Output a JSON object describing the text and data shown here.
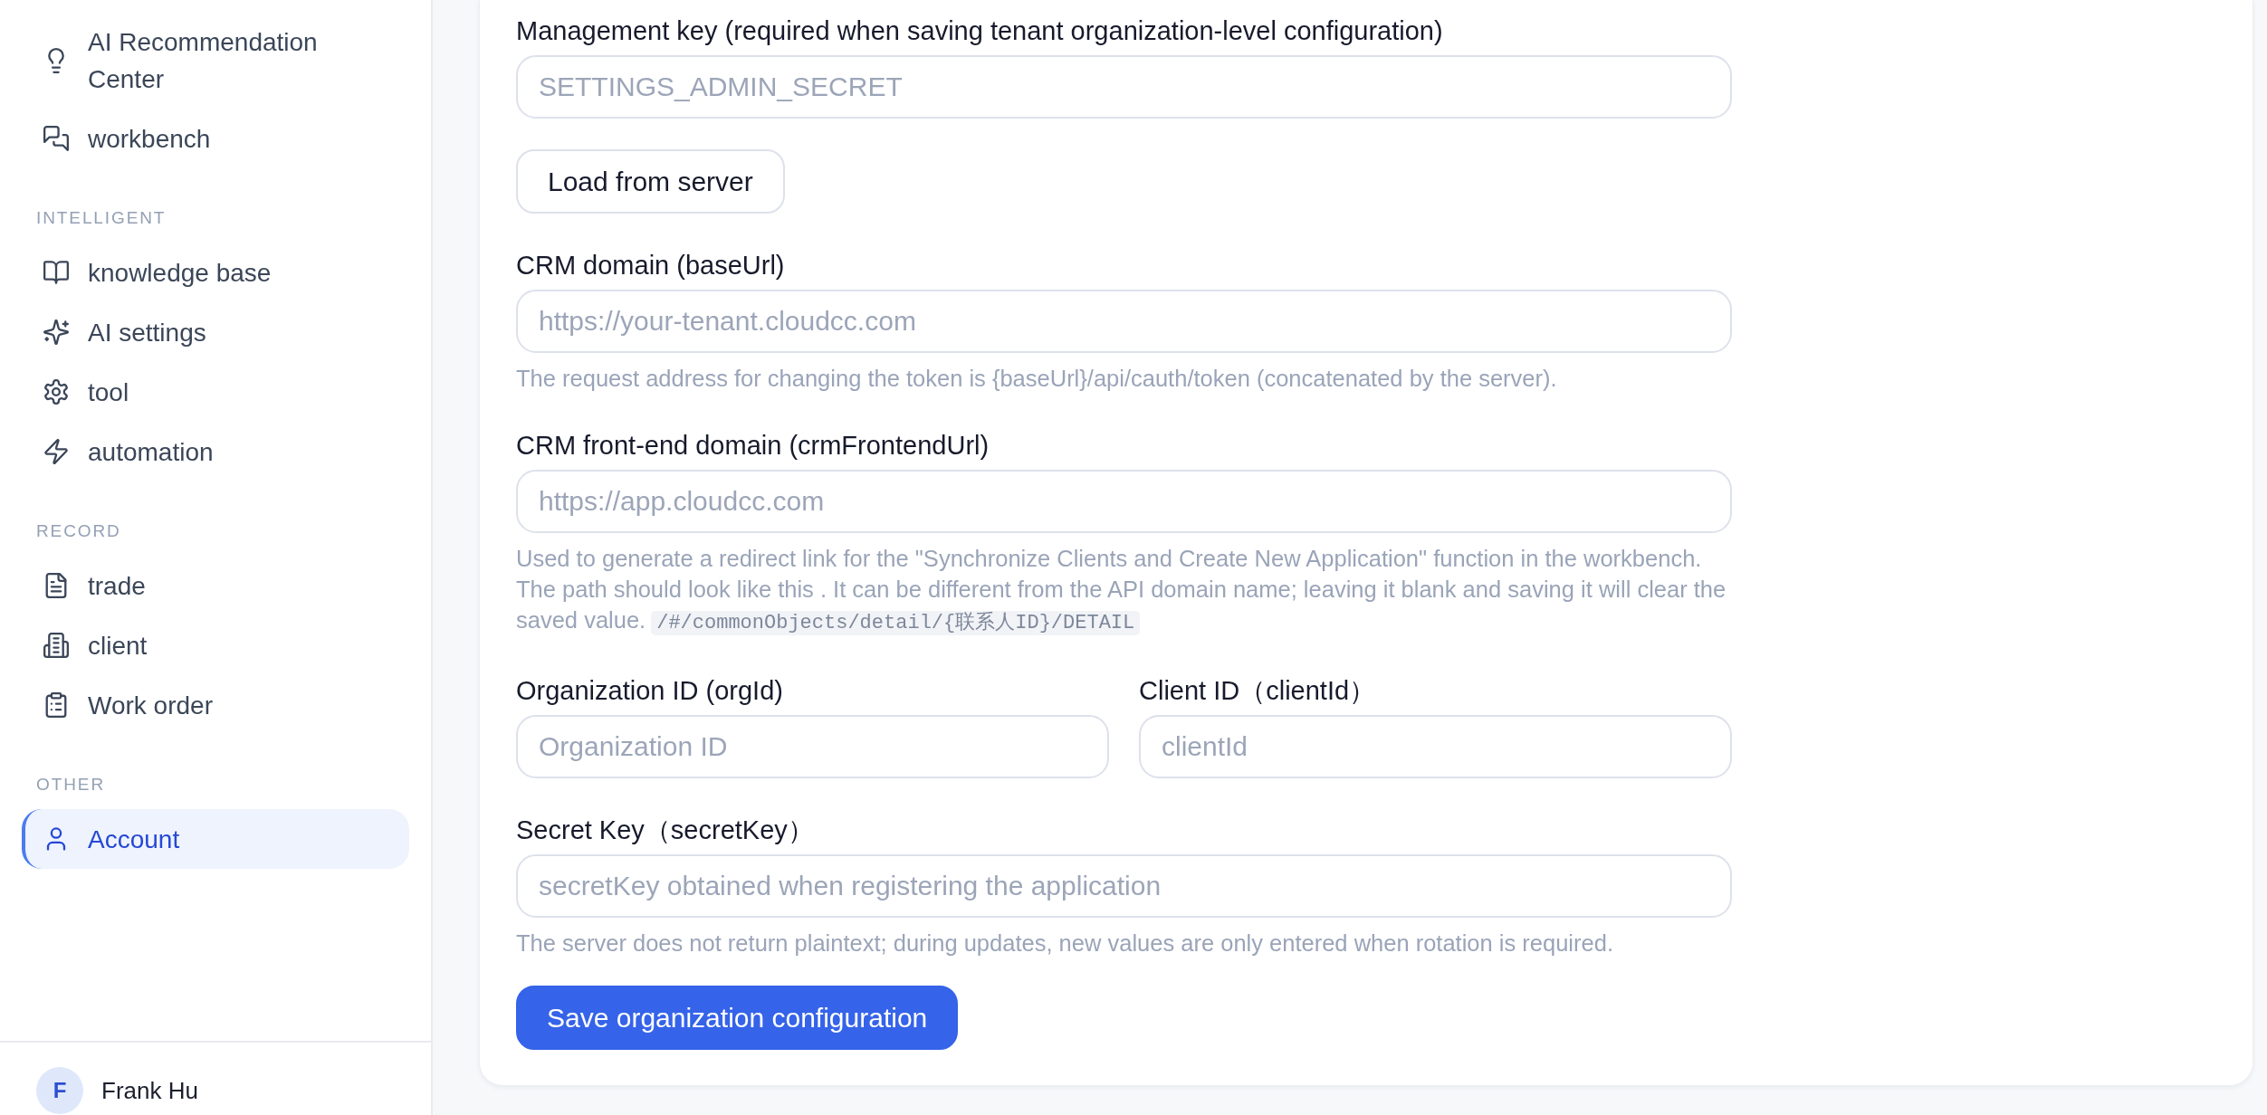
{
  "sidebar": {
    "groups": [
      {
        "items": [
          {
            "label": "AI Recommendation Center",
            "selected": false
          },
          {
            "label": "workbench",
            "selected": false
          }
        ]
      },
      {
        "title": "INTELLIGENT",
        "items": [
          {
            "label": "knowledge base",
            "selected": false
          },
          {
            "label": "AI settings",
            "selected": false
          },
          {
            "label": "tool",
            "selected": false
          },
          {
            "label": "automation",
            "selected": false
          }
        ]
      },
      {
        "title": "RECORD",
        "items": [
          {
            "label": "trade",
            "selected": false
          },
          {
            "label": "client",
            "selected": false
          },
          {
            "label": "Work order",
            "selected": false
          }
        ]
      },
      {
        "title": "OTHER",
        "items": [
          {
            "label": "Account",
            "selected": true
          }
        ]
      }
    ],
    "user": {
      "initial": "F",
      "name": "Frank Hu"
    }
  },
  "form": {
    "items": [
      {
        "kind": "field",
        "label": "Management key (required when saving tenant organization-level configuration)",
        "placeholder": "SETTINGS_ADMIN_SECRET"
      },
      {
        "kind": "button",
        "label": "Load from server"
      },
      {
        "kind": "field",
        "label": "CRM domain (baseUrl)",
        "placeholder": "https://your-tenant.cloudcc.com",
        "help": "The request address for changing the token is {baseUrl}/api/cauth/token (concatenated by the server)."
      },
      {
        "kind": "field",
        "label": "CRM front-end domain (crmFrontendUrl)",
        "placeholder": "https://app.cloudcc.com",
        "help": "Used to generate a redirect link for the \"Synchronize Clients and Create New Application\" function in the workbench. The path should look like this . It can be different from the API domain name; leaving it blank and saving it will clear the saved value.",
        "code": "/#/commonObjects/detail/{联系人ID}/DETAIL"
      },
      {
        "kind": "row",
        "fields": [
          {
            "label": "Organization ID (orgId)",
            "placeholder": "Organization ID"
          },
          {
            "label": "Client ID（clientId）",
            "placeholder": "clientId"
          }
        ]
      },
      {
        "kind": "field",
        "label": "Secret Key（secretKey）",
        "placeholder": "secretKey obtained when registering the application",
        "help": "The server does not return plaintext; during updates, new values are only entered when rotation is required."
      },
      {
        "kind": "primary_button",
        "label": "Save organization configuration"
      }
    ]
  }
}
